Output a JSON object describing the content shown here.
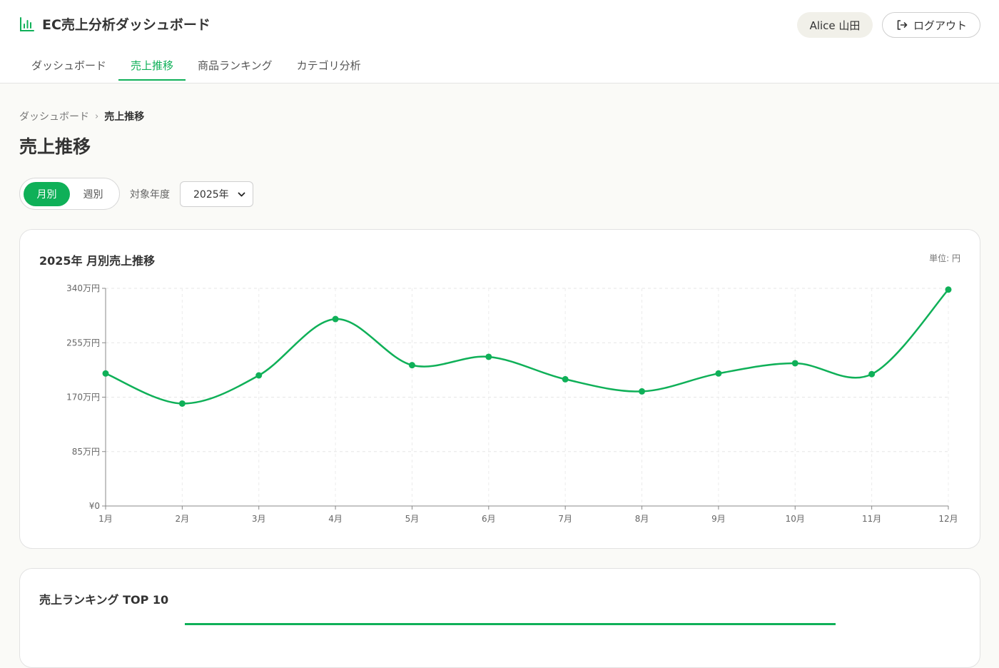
{
  "header": {
    "title": "EC売上分析ダッシュボード",
    "brand_icon": "bar-chart-icon",
    "user_name": "Alice 山田",
    "logout_label": "ログアウト",
    "logout_icon": "logout-icon"
  },
  "tabs": [
    {
      "label": "ダッシュボード",
      "active": false
    },
    {
      "label": "売上推移",
      "active": true
    },
    {
      "label": "商品ランキング",
      "active": false
    },
    {
      "label": "カテゴリ分析",
      "active": false
    }
  ],
  "breadcrumb": {
    "parent": "ダッシュボード",
    "current": "売上推移"
  },
  "page_title": "売上推移",
  "controls": {
    "period_options": [
      "月別",
      "週別"
    ],
    "selected_period": "月別",
    "year_label": "対象年度",
    "year_value": "2025年"
  },
  "chart_card": {
    "title": "2025年 月別売上推移",
    "unit": "単位: 円"
  },
  "ranking_card": {
    "title": "売上ランキング TOP 10"
  },
  "colors": {
    "accent": "#0fb058"
  },
  "chart_data": {
    "type": "line",
    "title": "2025年 月別売上推移",
    "categories": [
      "1月",
      "2月",
      "3月",
      "4月",
      "5月",
      "6月",
      "7月",
      "8月",
      "9月",
      "10月",
      "11月",
      "12月"
    ],
    "values": [
      2070000,
      1600000,
      2040000,
      2920000,
      2200000,
      2330000,
      1980000,
      1790000,
      2070000,
      2230000,
      2060000,
      3380000
    ],
    "ylim": [
      0,
      3400000
    ],
    "yticks": [
      0,
      850000,
      1700000,
      2550000,
      3400000
    ],
    "ytick_labels": [
      "¥0",
      "85万円",
      "170万円",
      "255万円",
      "340万円"
    ],
    "xlabel": "",
    "ylabel": "",
    "grid": true,
    "legend": "none"
  }
}
